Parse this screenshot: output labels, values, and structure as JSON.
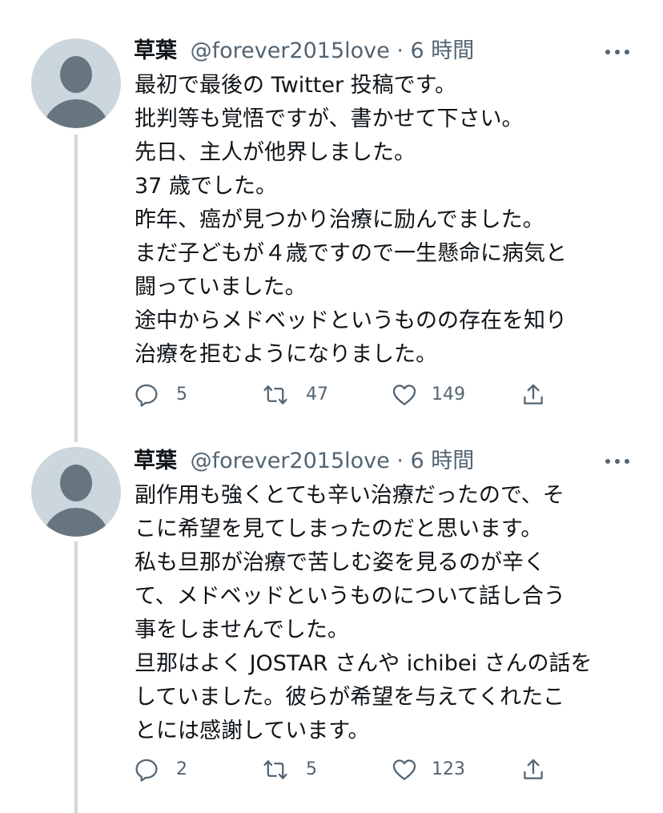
{
  "tweets": [
    {
      "display_name": "草葉",
      "handle": "@forever2015love",
      "separator": "·",
      "time": "6 時間",
      "lines": [
        "最初で最後の Twitter 投稿です。",
        "批判等も覚悟ですが、書かせて下さい。",
        "先日、主人が他界しました。",
        "37 歳でした。",
        "昨年、癌が見つかり治療に励んでました。",
        "まだ子どもが４歳ですので一生懸命に病気と",
        "闘っていました。",
        "途中からメドベッドというものの存在を知り",
        "治療を拒むようになりました。"
      ],
      "actions": {
        "replies": "5",
        "retweets": "47",
        "likes": "149"
      }
    },
    {
      "display_name": "草葉",
      "handle": "@forever2015love",
      "separator": "·",
      "time": "6 時間",
      "lines": [
        "副作用も強くとても辛い治療だったので、そ",
        "こに希望を見てしまったのだと思います。",
        "私も旦那が治療で苦しむ姿を見るのが辛く",
        "て、メドベッドというものについて話し合う",
        "事をしませんでした。",
        "旦那はよく JOSTAR さんや ichibei さんの話を",
        "していました。彼らが希望を与えてくれたこ",
        "とには感謝しています。"
      ],
      "actions": {
        "replies": "2",
        "retweets": "5",
        "likes": "123"
      }
    }
  ],
  "icons": {
    "reply": "reply-icon",
    "retweet": "retweet-icon",
    "like": "like-icon",
    "share": "share-icon",
    "more": "more-icon"
  },
  "colors": {
    "text": "#0f1419",
    "secondary": "#536471",
    "avatar_bg": "#ccd6dd",
    "avatar_fg": "#66757f",
    "thread_line": "#cfd9de"
  }
}
